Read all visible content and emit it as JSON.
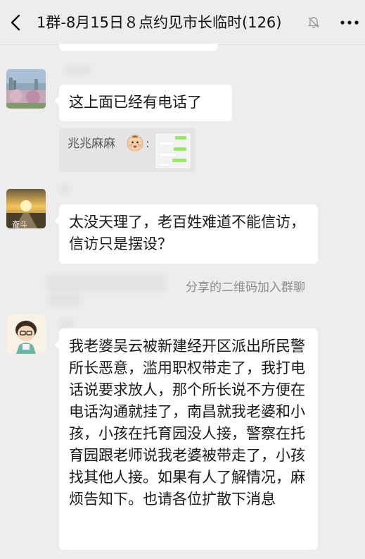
{
  "header": {
    "title": "1群-8月15日８点约见市长临时(126)",
    "icons": {
      "back": "back-arrow-icon",
      "mute": "mute-bell-icon",
      "more": "more-icon"
    }
  },
  "messages": [
    {
      "type": "text",
      "text": "这上面已经有电话了"
    },
    {
      "type": "quote",
      "sender": "兆兆麻麻",
      "separator": ":"
    },
    {
      "type": "text",
      "text": "太没天理了，老百姓难道不能信访，信访只是摆设？"
    },
    {
      "type": "system",
      "text": "分享的二维码加入群聊"
    },
    {
      "type": "text",
      "text": "我老婆吴云被新建经开区派出所民警所长恶意，滥用职权带走了，我打电话说要求放人，那个所长说不方便在电话沟通就挂了，南昌就我老婆和小孩，小孩在托育园没人接，警察在托育园跟老师说我老婆被带走了，小孩找其他人接。如果有人了解情况，麻烦告知下。也请各位扩散下消息"
    }
  ],
  "avatar_text": {
    "sunset": "奋斗"
  },
  "colors": {
    "background": "#ededed",
    "bubble": "#ffffff",
    "text": "#191919",
    "system_text": "#8c8c8c"
  }
}
